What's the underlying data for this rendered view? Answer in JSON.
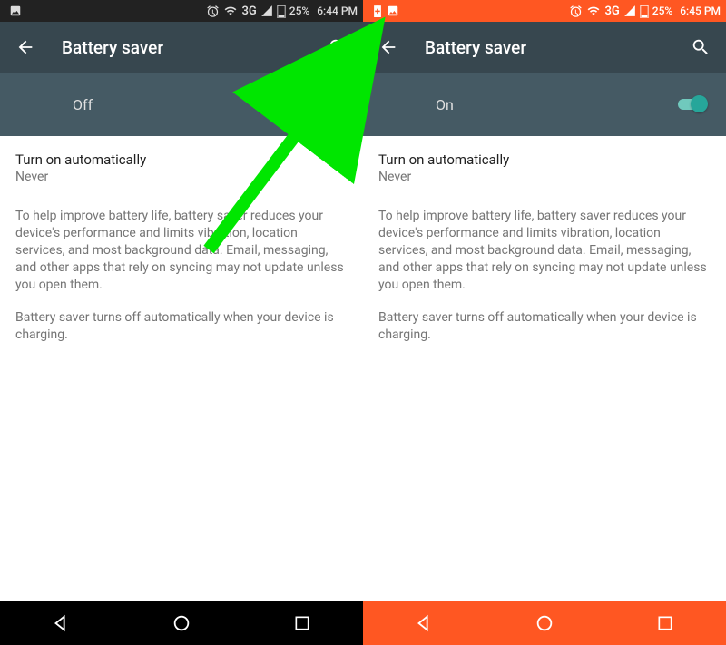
{
  "left": {
    "statusbar": {
      "battery_pct": "25%",
      "time": "6:44 PM",
      "net": "3G"
    },
    "appbar": {
      "title": "Battery saver"
    },
    "toggle": {
      "state": "Off",
      "on": false
    },
    "option": {
      "title": "Turn on automatically",
      "value": "Never"
    },
    "desc1": "To help improve battery life, battery saver reduces your device's performance and limits vibration, location services, and most background data. Email, messaging, and other apps that rely on syncing may not update unless you open them.",
    "desc2": "Battery saver turns off automatically when your device is charging."
  },
  "right": {
    "statusbar": {
      "battery_pct": "25%",
      "time": "6:45 PM",
      "net": "3G"
    },
    "appbar": {
      "title": "Battery saver"
    },
    "toggle": {
      "state": "On",
      "on": true
    },
    "option": {
      "title": "Turn on automatically",
      "value": "Never"
    },
    "desc1": "To help improve battery life, battery saver reduces your device's performance and limits vibration, location services, and most background data. Email, messaging, and other apps that rely on syncing may not update unless you open them.",
    "desc2": "Battery saver turns off automatically when your device is charging."
  },
  "annotation": {
    "arrow_color": "#00e600"
  }
}
